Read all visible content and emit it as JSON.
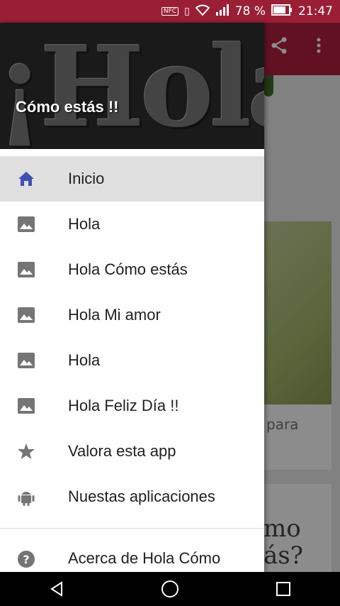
{
  "status_bar": {
    "nfc": "NFC",
    "battery_percent": "78 %",
    "time": "21:47"
  },
  "drawer": {
    "header_title": "Cómo estás !!",
    "header_art_text": "¡Hola!",
    "items": [
      {
        "label": "Inicio",
        "icon": "home-icon",
        "active": true
      },
      {
        "label": "Hola",
        "icon": "image-icon"
      },
      {
        "label": "Hola Cómo estás",
        "icon": "image-icon"
      },
      {
        "label": "Hola Mi amor",
        "icon": "image-icon"
      },
      {
        "label": "Hola",
        "icon": "image-icon"
      },
      {
        "label": "Hola Feliz Día !!",
        "icon": "image-icon"
      },
      {
        "label": "Valora esta app",
        "icon": "star-icon"
      },
      {
        "label": "Nuestas aplicaciones",
        "icon": "android-icon"
      }
    ],
    "footer_items": [
      {
        "label": "Acerca de Hola Cómo",
        "icon": "help-icon"
      }
    ]
  },
  "background": {
    "card1_caption": "para",
    "card2_text": "mo\nás?"
  },
  "colors": {
    "primary": "#b3203e",
    "status_bar": "#9a1f36",
    "active_icon": "#3f51b5",
    "icon_grey": "#757575"
  }
}
